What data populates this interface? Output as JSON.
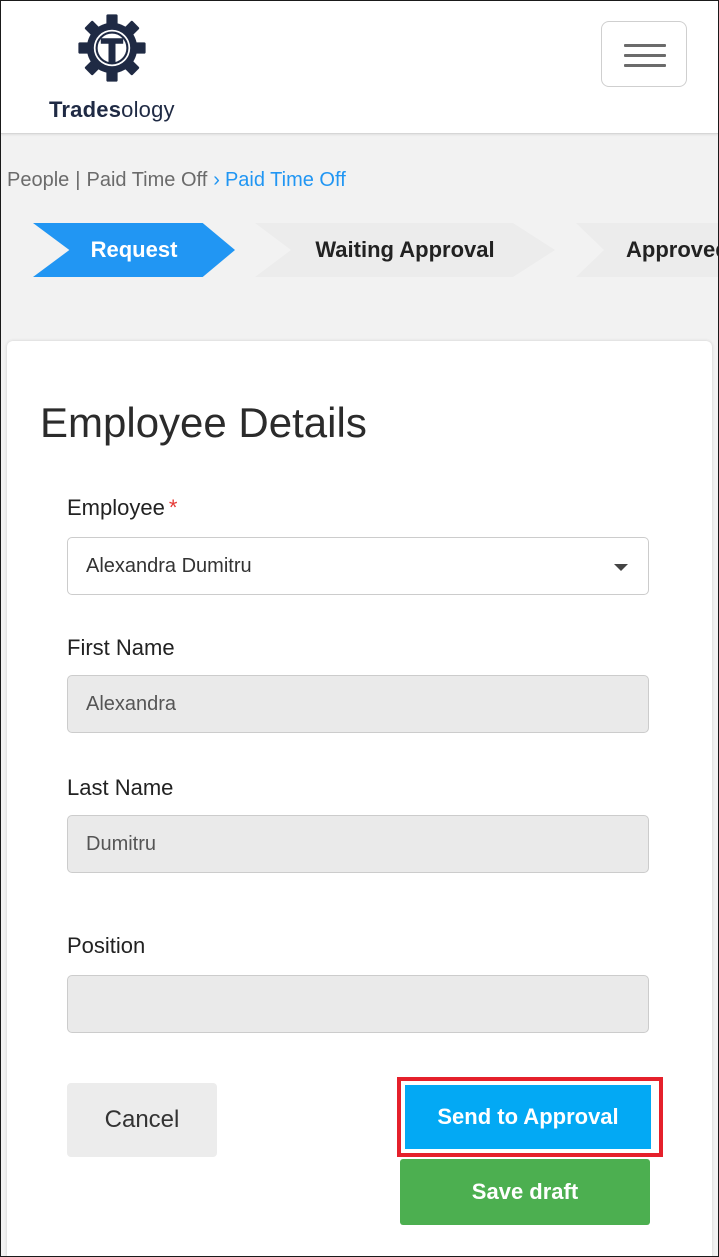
{
  "header": {
    "logo_bold": "Trades",
    "logo_rest": "ology",
    "lang": "en"
  },
  "breadcrumb": {
    "part1": "People",
    "sep": "|",
    "part2": "Paid Time Off",
    "chevron": "›",
    "current": "Paid Time Off"
  },
  "steps": {
    "request": "Request",
    "waiting": "Waiting Approval",
    "approved": "Approved"
  },
  "form": {
    "title": "Employee Details",
    "employee_label": "Employee",
    "required_mark": "*",
    "employee_value": "Alexandra Dumitru",
    "first_name_label": "First Name",
    "first_name_value": "Alexandra",
    "last_name_label": "Last Name",
    "last_name_value": "Dumitru",
    "position_label": "Position",
    "position_value": ""
  },
  "actions": {
    "cancel": "Cancel",
    "send": "Send to Approval",
    "draft": "Save draft"
  },
  "colors": {
    "accent": "#2196f3",
    "send_button": "#03a9f4",
    "draft_button": "#4caf50",
    "highlight_border": "#e5202b",
    "required": "#e53935"
  }
}
